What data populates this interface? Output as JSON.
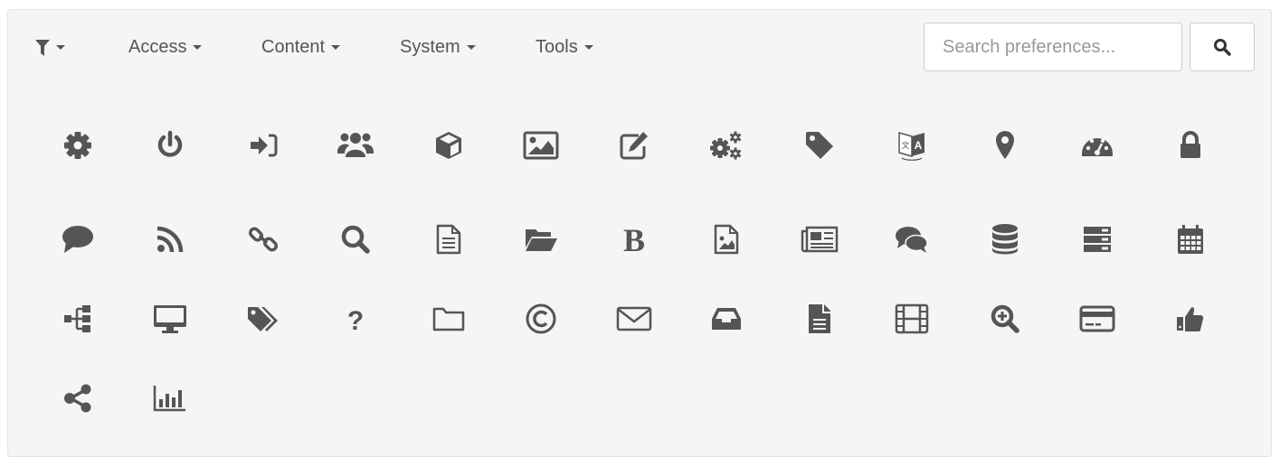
{
  "toolbar": {
    "filter_icon": "filter-icon",
    "menus": [
      {
        "label": "Access"
      },
      {
        "label": "Content"
      },
      {
        "label": "System"
      },
      {
        "label": "Tools"
      }
    ],
    "search": {
      "placeholder": "Search preferences...",
      "value": ""
    },
    "search_button_icon": "search-icon"
  },
  "icons": [
    "cog",
    "power",
    "sign-in",
    "users",
    "cube",
    "image",
    "edit",
    "cogs",
    "tag",
    "translate",
    "map-marker",
    "dashboard",
    "lock",
    "comment",
    "rss",
    "link",
    "search",
    "file-text",
    "folder-open",
    "bold",
    "file-image",
    "newspaper",
    "comments",
    "database",
    "server",
    "calendar",
    "sitemap",
    "desktop",
    "tags",
    "question",
    "folder",
    "copyright",
    "envelope",
    "inbox",
    "file",
    "film",
    "zoom-in",
    "credit-card",
    "thumbs-up",
    "share",
    "bar-chart"
  ],
  "colors": {
    "icon": "#555555",
    "panel_bg": "#f5f5f5",
    "border": "#cccccc"
  }
}
